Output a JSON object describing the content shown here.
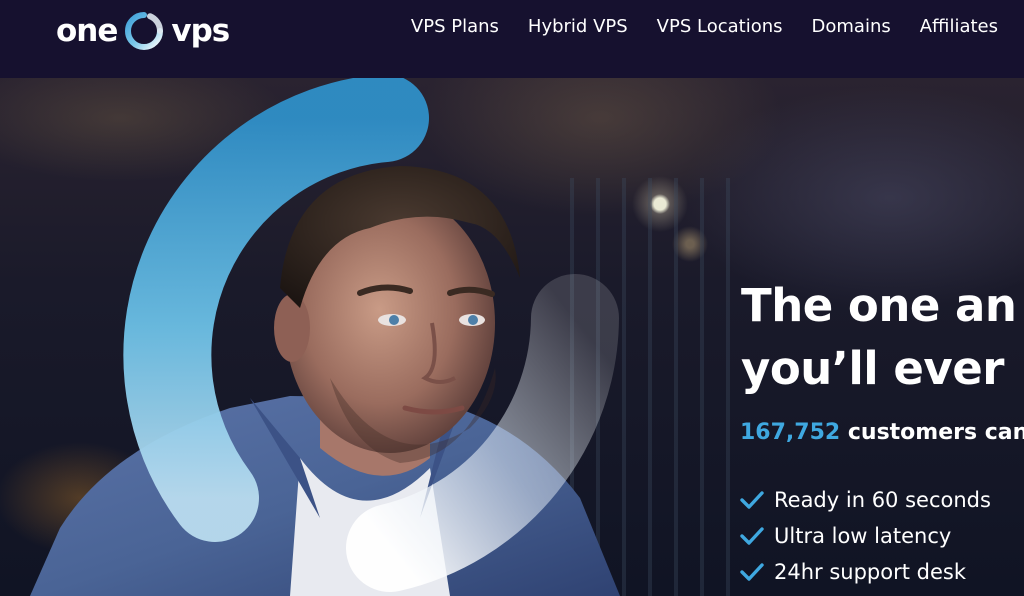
{
  "brand": {
    "logo_left": "one",
    "logo_right": "vps",
    "ring_icon": "logo-ring-icon",
    "accent": "#3fa8e0"
  },
  "nav": {
    "items": [
      {
        "label": "VPS Plans"
      },
      {
        "label": "Hybrid VPS"
      },
      {
        "label": "VPS Locations"
      },
      {
        "label": "Domains"
      },
      {
        "label": "Affiliates"
      }
    ]
  },
  "hero": {
    "headline_line1": "The one an",
    "headline_line2": "you’ll ever",
    "customers_count": "167,752",
    "customers_text": " customers can’t",
    "features": [
      {
        "label": "Ready in 60 seconds",
        "icon": "check-icon"
      },
      {
        "label": "Ultra low latency",
        "icon": "check-icon"
      },
      {
        "label": "24hr support desk",
        "icon": "check-icon"
      }
    ]
  },
  "colors": {
    "header_bg": "#16112f",
    "check": "#3fa8e0",
    "count": "#3fa8e0"
  }
}
